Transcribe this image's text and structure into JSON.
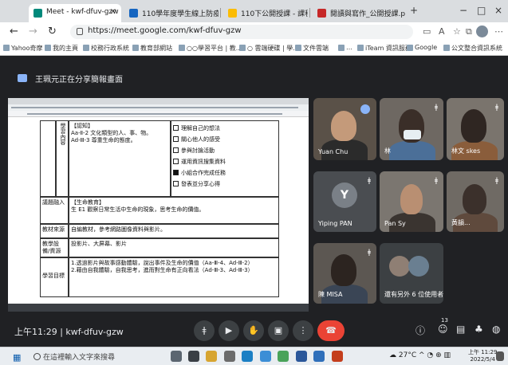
{
  "browser": {
    "tabs": [
      {
        "label": "Meet - kwf-dfuv-gzw",
        "active": true
      },
      {
        "label": "110學年度學生線上防疫學習課程表..."
      },
      {
        "label": "110下公開授課 - 課程資料 - Goo"
      },
      {
        "label": "閱讀與寫作_公開授課.pdf"
      }
    ],
    "new_tab": "+",
    "window_controls": [
      "−",
      "□",
      "×"
    ],
    "url": "https://meet.google.com/kwf-dfuv-gzw",
    "bookmarks": [
      "Yahoo奇摩",
      "我的主頁",
      "校務行政系統",
      "教育部網站",
      "○○學習平台 | 教...",
      "○ 雲端硬碟 | 學...",
      "文件雲端",
      "…",
      "iTeam 資訊服務",
      "Google",
      "公文整合資訊系統"
    ]
  },
  "meet": {
    "presenting_banner": "王珮元正在分享簡報畫面",
    "shared_doc": {
      "rows": [
        {
          "header": "學習內容",
          "content": "【認知】\nAa-Ⅱ-2 文化類型的人、事、物。\nAd-Ⅲ-3 尊重生命的態度。"
        },
        {
          "header": "議題融入",
          "content": "【生命教育】\n生 E1 觀察日常生活中生命的現象，思考生命的價值。"
        },
        {
          "header": "教材來源",
          "content": "自編教材，參考網路圖像資料與影片。"
        },
        {
          "header": "教學設備/資源",
          "content": "投影片、大屏幕、影片"
        },
        {
          "header": "學習目標",
          "content": "1.透過影片與故事感動體驗，說出事件及生命的價值（Aa-Ⅲ-4、Ad-Ⅲ-2）\n2.藉由自我體驗，自我思考，進而對生命有正向看法（Ad-Ⅲ-3、Ad-Ⅲ-3）"
        }
      ],
      "checklist": [
        {
          "label": "理解自己的想法",
          "checked": false
        },
        {
          "label": "關心他人的感受",
          "checked": false
        },
        {
          "label": "參與討論活動",
          "checked": false
        },
        {
          "label": "運用資訊搜集資料",
          "checked": false
        },
        {
          "label": "小組合作完成任務",
          "checked": true
        },
        {
          "label": "發表並分享心得",
          "checked": false
        }
      ]
    },
    "participants": [
      {
        "name": "Yuan Chu",
        "mic_off": false
      },
      {
        "name": "林",
        "mic_off": true
      },
      {
        "name": "林文 skes",
        "mic_off": true
      },
      {
        "name": "Yiping PAN",
        "mic_off": true,
        "initial": "Y"
      },
      {
        "name": "Pan Sy",
        "mic_off": true
      },
      {
        "name": "黃韻...",
        "mic_off": true
      },
      {
        "name": "陳 MISA",
        "mic_off": true
      },
      {
        "name": "還有另外 6 位使用者",
        "mic_off": false
      }
    ],
    "footer": {
      "time_code": "上午11:29 | kwf-dfuv-gzw",
      "participant_count": "13"
    }
  },
  "taskbar": {
    "search_placeholder": "在這裡輸入文字來搜尋",
    "weather": "27°C",
    "time": "上午 11:29",
    "date": "2022/5/4"
  },
  "colors": {
    "meet_bg": "#202124",
    "tile_bg": "#3c4043",
    "end_call": "#ea4335",
    "accent": "#8ab4f8"
  }
}
